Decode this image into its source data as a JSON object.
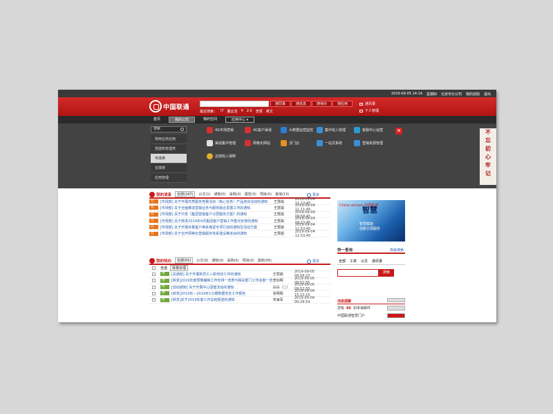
{
  "topbar": {
    "datetime": "2019-09-05 14:14",
    "weekday": "星期四",
    "location": "北京市分公司",
    "my_settings": "我的自助",
    "logout": "退出"
  },
  "header": {
    "logo_text": "中国联通",
    "search_placeholder": "",
    "search_tabs": [
      "搜同事",
      "搜信息",
      "搜待办",
      "搜应用"
    ],
    "hotline": [
      "最近搜索：",
      "IT",
      "董云龙",
      "¥",
      "2.0",
      "李慧",
      "英文"
    ],
    "links": [
      "通讯录",
      "个人管理"
    ]
  },
  "nav": {
    "items": [
      "首页",
      "我的公司",
      "我的空间",
      "应用中心"
    ]
  },
  "mega": {
    "search_placeholder": "搜索",
    "left_items": [
      "常用业务应用",
      "党建和管理类",
      "市场类",
      "支撑类",
      "应用管理"
    ],
    "apps": [
      {
        "label": "4G市场营销",
        "color": "#d83030"
      },
      {
        "label": "4G客户渠道",
        "color": "#d83030"
      },
      {
        "label": "大数据运营监控",
        "color": "#2a7fd4"
      },
      {
        "label": "集中收入管理",
        "color": "#3a8fd8"
      },
      {
        "label": "客服中心运营",
        "color": "#2a9ad4"
      },
      {
        "label": "渠道集中管理",
        "color": "#e0e0e0"
      },
      {
        "label": "网格化网站",
        "color": "#d83030"
      },
      {
        "label": "沃门店",
        "color": "#e89020"
      },
      {
        "label": "一站式系统",
        "color": "#3a8fd8"
      },
      {
        "label": "营销资源管理",
        "color": "#3a8fd8"
      },
      {
        "label": "总部收入保障",
        "color": "#e0b030"
      }
    ]
  },
  "side_banner": [
    "不",
    "忘",
    "初",
    "心",
    "牢",
    "记",
    "使",
    "命"
  ],
  "messages_section": {
    "title": "我的消息",
    "tabs": [
      "全部(247)",
      "公文(1)",
      "通知(0)",
      "采购(0)",
      "报告(0)",
      "项目(0)",
      "其他(13)"
    ],
    "more": "更多",
    "tag_label": "公文",
    "rows": [
      {
        "title": "[市场部] 关于开展优质服务竞赛活动（核心任务）产品培训活动的通知",
        "author": "王慧娟",
        "date": "2019-09-04 11:13:45"
      },
      {
        "title": "[市场部] 关于全面推进营销业务与服务融合发展工作的通知",
        "author": "王慧娟",
        "date": "2019-09-04 11:11:45"
      },
      {
        "title": "[市场部] 关于印发《集团营销客户分层服务方案》的通知",
        "author": "王慧娟",
        "date": "2019-09-04 09:58:45"
      },
      {
        "title": "[市场部] 关于转发2019年9月集团客户营销工作重点安排的通知",
        "author": "王慧娟",
        "date": "2019-09-04 09:23:45"
      },
      {
        "title": "[市场部] 关于开展存量客户维系挽留专项行动的通知及活动方案",
        "author": "王慧娟",
        "date": "2019-09-04 11:53:45"
      },
      {
        "title": "[市场部] 关于召开网格化营销服务体系建设推进会的通知",
        "author": "王慧娟",
        "date": "2019-09-04 11:53:45"
      }
    ]
  },
  "todo_section": {
    "title": "我的待办",
    "tabs": [
      "全部(65)",
      "公文(9)",
      "通知(0)",
      "采购(0)",
      "项目(0)",
      "其他(56)"
    ],
    "more": "更多",
    "select_all": "全选",
    "batch": "批量处理",
    "tag_label": "待办",
    "rows": [
      {
        "title": "[关通知] 关于开展新员工入职培训工作的通知",
        "author": "王慧娟",
        "date": "2019-09-05 09:56:23"
      },
      {
        "title": "[转发]2019年度预算编制工作安排一览表与相关部门工作进度一览表",
        "author": "李剑明",
        "date": "2019-09-05 09:52:55"
      },
      {
        "title": "[活动通知] 关于开展中心团建活动的通知",
        "author": "白白（二）",
        "date": "2019-09-05 09:52:55"
      },
      {
        "title": "[转发]2019年—2019年1分期数据安全工作报告",
        "author": "张明辉",
        "date": "2019-09-04 15:23:15"
      },
      {
        "title": "[转发]关于2019年度工作总结报送的通知",
        "author": "宋海军",
        "date": "2019-09-04 09:29:54"
      }
    ]
  },
  "banner": {
    "corner": "China unicom 中国联通",
    "title": "智慧",
    "line1": "智慧赋能",
    "line2": "创新引领服务"
  },
  "quick": {
    "title": "快一查询",
    "more": "高级搜索",
    "tabs": [
      "全部",
      "工单",
      "公文",
      "通讯录"
    ],
    "button": "搜索"
  },
  "msg_box": {
    "title": "消息提醒",
    "line1_prefix": "您有",
    "line1_count": "86",
    "line1_suffix": "封未读邮件",
    "line2": "中国联通智慧门户"
  }
}
